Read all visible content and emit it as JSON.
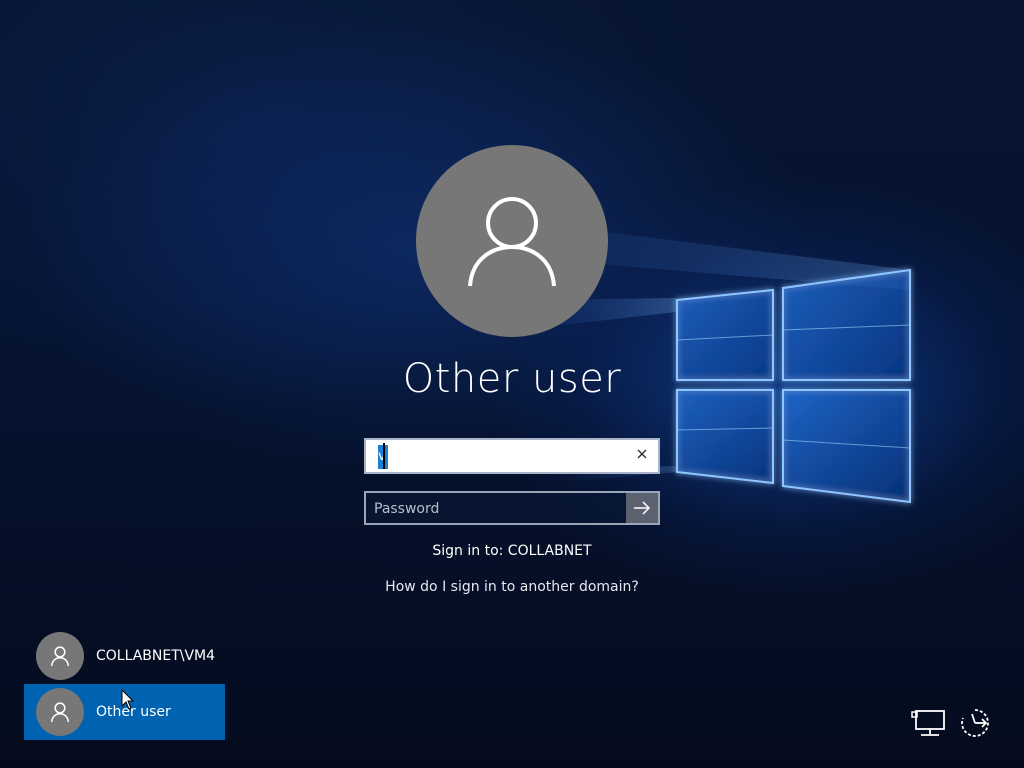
{
  "login": {
    "display_name": "Other user",
    "username_value": "",
    "username_selected_char": "v",
    "password_placeholder": "Password",
    "signin_to_text": "Sign in to: COLLABNET",
    "domain_help_link": "How do I sign in to another domain?"
  },
  "user_list": [
    {
      "label": "COLLABNET\\VM4",
      "selected": false
    },
    {
      "label": "Other user",
      "selected": true
    }
  ],
  "icons": {
    "avatar": "user-silhouette-icon",
    "clear": "close-icon",
    "submit": "arrow-right-icon",
    "network": "network-icon",
    "ease_of_access": "ease-of-access-icon"
  },
  "colors": {
    "accent": "#0063b1",
    "avatar_bg": "#777777"
  }
}
